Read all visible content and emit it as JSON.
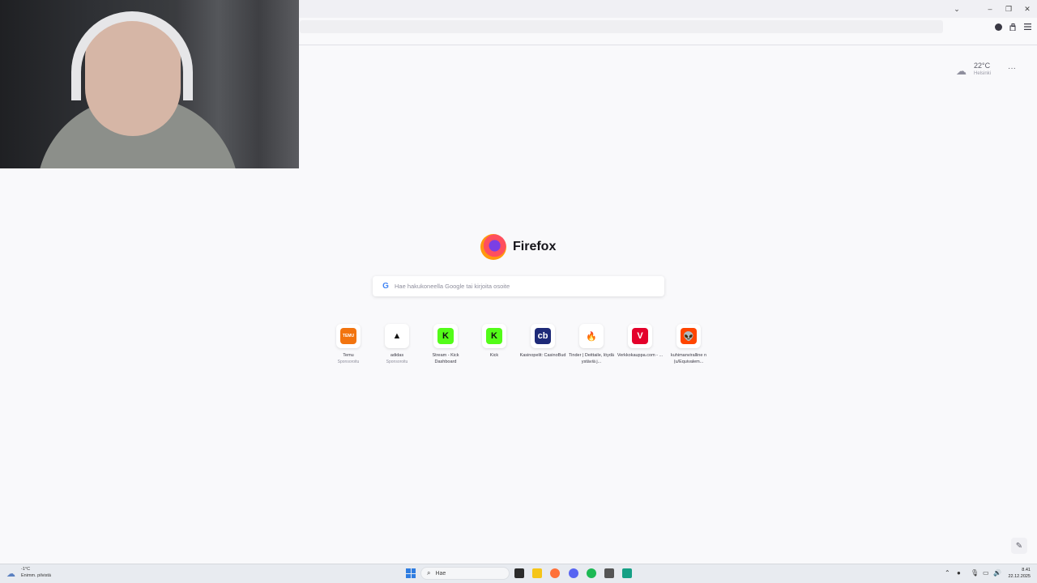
{
  "browser": {
    "window_controls": {
      "list_tabs": "⌄",
      "minimize": "–",
      "restore": "❐",
      "close": "✕"
    },
    "toolbar_icons": [
      "account-icon",
      "extensions-icon",
      "menu-icon"
    ]
  },
  "weather": {
    "temperature": "22°C",
    "location": "Helsinki"
  },
  "logo": {
    "wordmark": "Firefox"
  },
  "search": {
    "placeholder": "Hae hakukoneella Google tai kirjoita osoite",
    "engine_glyph": "G"
  },
  "top_sites": [
    {
      "title": "Temu",
      "sponsored": "Sponsoroitu",
      "glyph": "TEMU",
      "color": "#f2740f"
    },
    {
      "title": "adidas",
      "sponsored": "Sponsoroitu",
      "glyph": "▲",
      "color": "#ffffff"
    },
    {
      "title": "Stream - Kick Dashboard",
      "sponsored": "",
      "glyph": "K",
      "color": "#53fc18"
    },
    {
      "title": "Kick",
      "sponsored": "",
      "glyph": "K",
      "color": "#53fc18"
    },
    {
      "title": "Kasinopelit: CasinoBud",
      "sponsored": "",
      "glyph": "cb",
      "color": "#1e2a78"
    },
    {
      "title": "Tinder | Deittaile, löydä ystäviä j...",
      "sponsored": "",
      "glyph": "🔥",
      "color": "#ffffff"
    },
    {
      "title": "Verkkokauppa.com - ...",
      "sponsored": "",
      "glyph": "V",
      "color": "#e4002b"
    },
    {
      "title": "kuhimanviralline n (u/Equivalem...",
      "sponsored": "",
      "glyph": "👽",
      "color": "#ff4500"
    }
  ],
  "taskbar": {
    "weather_temp": "-1°C",
    "weather_desc": "Enimm. pilvistä",
    "search_label": "Hae",
    "time": "8.41",
    "date": "22.12.2025"
  }
}
